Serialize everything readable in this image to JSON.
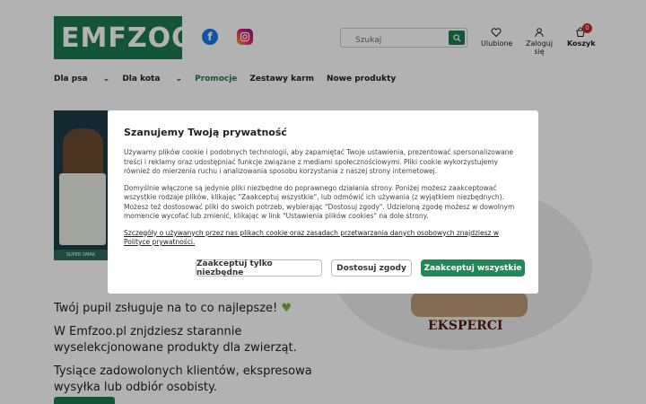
{
  "header": {
    "logo_text": "EMFZOO",
    "search_placeholder": "Szukaj",
    "favorites_label": "Ulubione",
    "login_label": "Zaloguj się",
    "cart_label": "Koszyk",
    "cart_count": "0"
  },
  "nav": {
    "items": [
      "Dla psa",
      "Dla kota",
      "Promocje",
      "Zestawy karm",
      "Nowe produkty"
    ]
  },
  "banner": {
    "strip_text": "SUPER SMAK"
  },
  "eksperci": "EKSPERCI",
  "hero": {
    "line1": "Twój pupil zsługuje na to co najlepsze!",
    "line2": "W Emfzoo.pl znjdziesz starannie wyselekcjonowane produkty dla zwierząt.",
    "line3": "Tysiące zadowolonych klientów, ekspresowa wysyłka lub odbiór osobisty."
  },
  "cookie": {
    "title": "Szanujemy Twoją prywatność",
    "para1": "Używamy plików cookie i podobnych technologii, aby zapamiętać Twoje ustawienia, prezentować spersonalizowane treści i reklamy oraz udostępniać funkcje związane z mediami społecznościowymi. Pliki cookie wykorzystujemy również do mierzenia ruchu i analizowania sposobu korzystania z naszej strony internetowej.",
    "para2": "Domyślnie włączone są jedynie pliki niezbędne do poprawnego działania strony. Poniżej możesz zaakceptować wszystkie rodzaje plików, klikając \"Zaakceptuj wszystkie\", lub odmówić ich używania (z wyjątkiem niezbędnych). Możesz też dostosować pliki do swoich potrzeb, wybierając \"Dostosuj zgody\". Udzieloną zgodę możesz w dowolnym momencie wycofać lub zmienić, klikając w link \"Ustawienia plików cookies\" na dole strony.",
    "link": "Szczegóły o używanych przez nas plikach cookie oraz zasadach przetwarzania danych osobowych znajdziesz w Polityce prywatności.",
    "btn_necessary": "Zaakceptuj tylko niezbędne",
    "btn_customize": "Dostosuj zgody",
    "btn_accept_all": "Zaakceptuj wszystkie"
  },
  "colors": {
    "brand": "#1f7a4f",
    "accept": "#1f8a55",
    "badge": "#c62828"
  }
}
